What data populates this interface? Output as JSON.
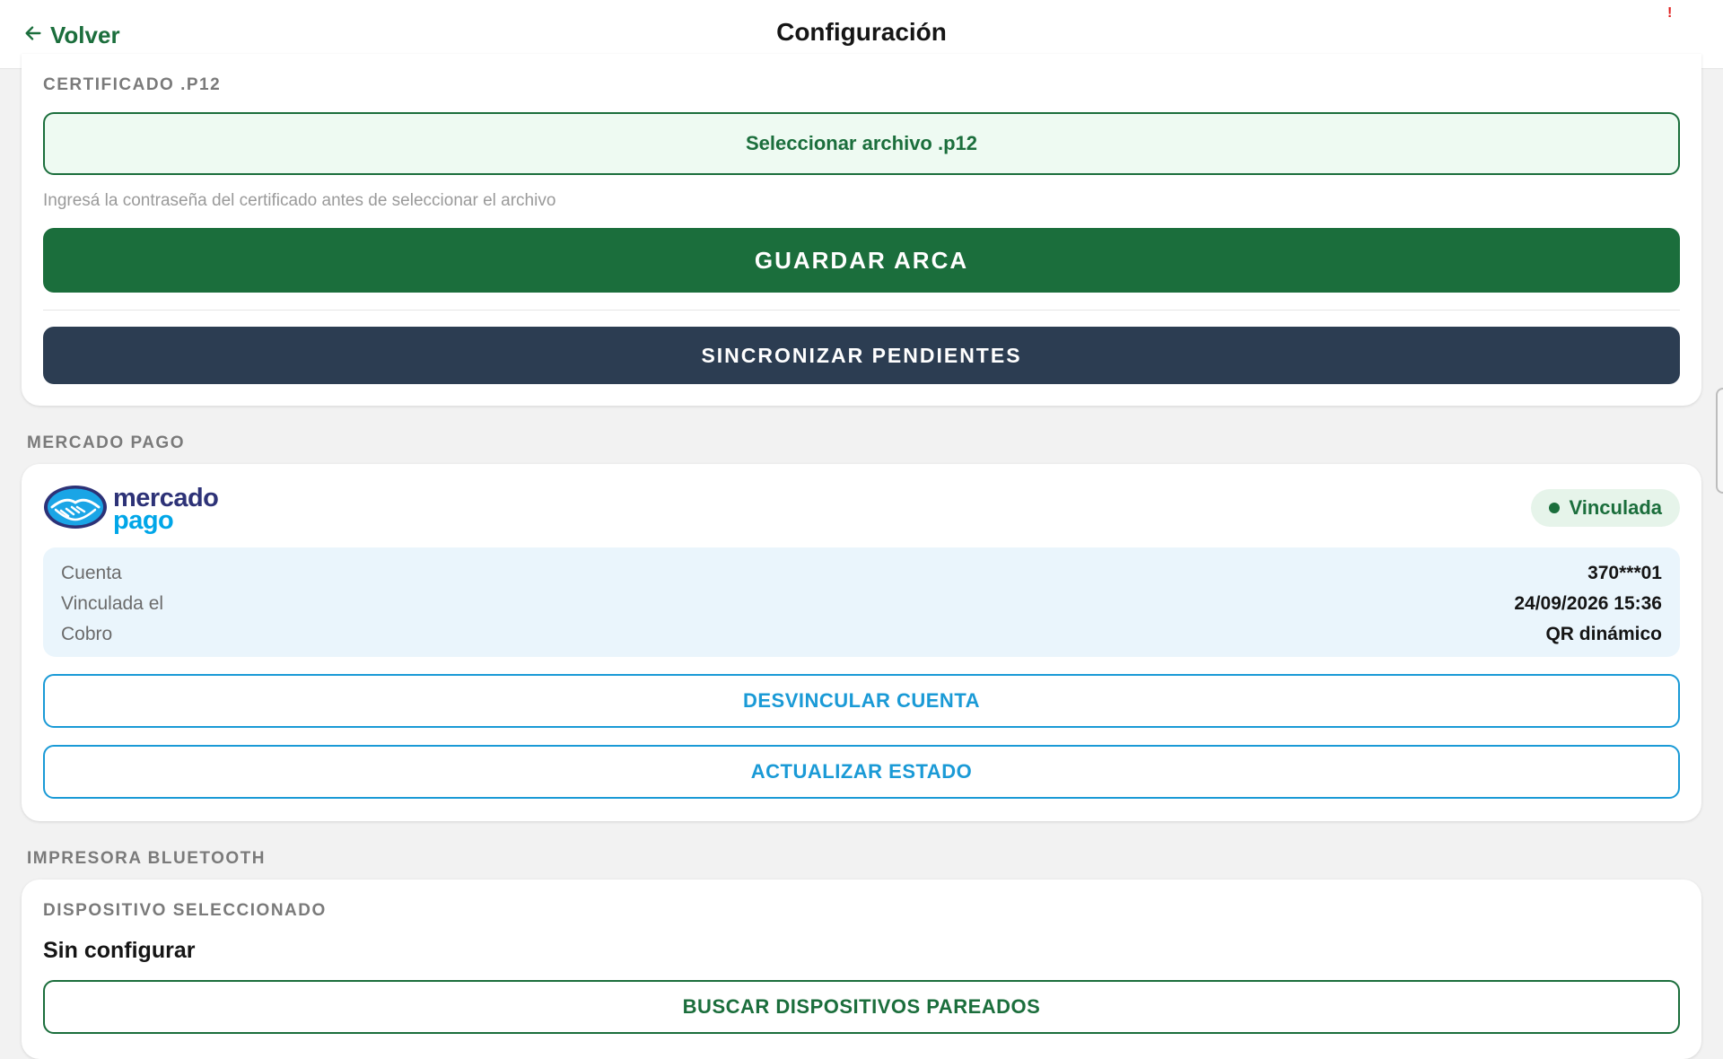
{
  "header": {
    "back_label": "Volver",
    "title": "Configuración",
    "alert_mark": "!"
  },
  "arca": {
    "certificate_label": "CERTIFICADO .P12",
    "select_file_label": "Seleccionar archivo .p12",
    "hint": "Ingresá la contraseña del certificado antes de seleccionar el archivo",
    "save_label": "GUARDAR ARCA",
    "sync_label": "SINCRONIZAR PENDIENTES"
  },
  "mercado_pago": {
    "section_label": "MERCADO PAGO",
    "logo_word1": "mercado",
    "logo_word2": "pago",
    "status": "Vinculada",
    "info": [
      {
        "key": "Cuenta",
        "value": "370***01"
      },
      {
        "key": "Vinculada el",
        "value": "24/09/2026 15:36"
      },
      {
        "key": "Cobro",
        "value": "QR dinámico"
      }
    ],
    "unlink_label": "DESVINCULAR CUENTA",
    "refresh_label": "ACTUALIZAR ESTADO"
  },
  "printer": {
    "section_label": "IMPRESORA BLUETOOTH",
    "device_label": "DISPOSITIVO SELECCIONADO",
    "device_value": "Sin configurar",
    "search_label": "BUSCAR DISPOSITIVOS PAREADOS"
  },
  "icons": {
    "back": "arrow-left-icon",
    "mp_logo": "handshake-icon"
  },
  "colors": {
    "primary_green": "#1b6e3c",
    "dark_button": "#2c3d52",
    "mp_blue": "#1a9ad6",
    "mp_navy": "#2d3277",
    "info_bg": "#eaf5fc",
    "status_bg": "#e6f4ea",
    "alert_red": "#e0201f"
  }
}
